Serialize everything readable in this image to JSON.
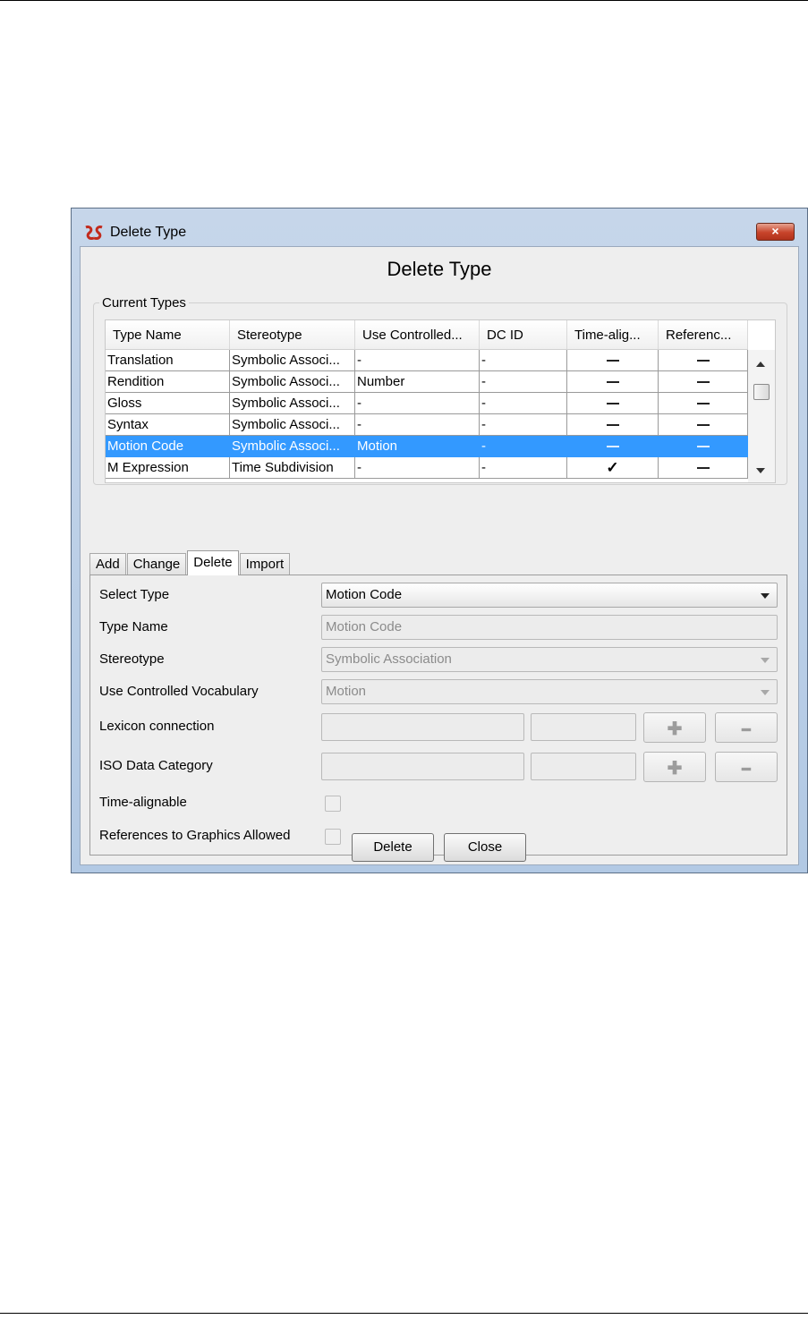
{
  "dialog": {
    "window_title": "Delete Type",
    "heading": "Delete Type",
    "close_glyph": "×"
  },
  "current_types": {
    "label": "Current Types",
    "columns": [
      "Type Name",
      "Stereotype",
      "Use Controlled...",
      "DC ID",
      "Time-alig...",
      "Referenc..."
    ],
    "rows": [
      {
        "name": "Translation",
        "stereotype": "Symbolic Associ...",
        "vocab": "-",
        "dcid": "-",
        "time_alignable": "dash",
        "references": "dash",
        "selected": false
      },
      {
        "name": "Rendition",
        "stereotype": "Symbolic Associ...",
        "vocab": "Number",
        "dcid": "-",
        "time_alignable": "dash",
        "references": "dash",
        "selected": false
      },
      {
        "name": "Gloss",
        "stereotype": "Symbolic Associ...",
        "vocab": "-",
        "dcid": "-",
        "time_alignable": "dash",
        "references": "dash",
        "selected": false
      },
      {
        "name": "Syntax",
        "stereotype": "Symbolic Associ...",
        "vocab": "-",
        "dcid": "-",
        "time_alignable": "dash",
        "references": "dash",
        "selected": false
      },
      {
        "name": "Motion Code",
        "stereotype": "Symbolic Associ...",
        "vocab": "Motion",
        "dcid": "-",
        "time_alignable": "dash",
        "references": "dash",
        "selected": true
      },
      {
        "name": "M Expression",
        "stereotype": "Time Subdivision",
        "vocab": "-",
        "dcid": "-",
        "time_alignable": "check",
        "references": "dash",
        "selected": false
      }
    ]
  },
  "tabs": [
    {
      "label": "Add",
      "active": false
    },
    {
      "label": "Change",
      "active": false
    },
    {
      "label": "Delete",
      "active": true
    },
    {
      "label": "Import",
      "active": false
    }
  ],
  "form": {
    "select_type_label": "Select Type",
    "select_type_value": "Motion Code",
    "type_name_label": "Type Name",
    "type_name_value": "Motion Code",
    "stereotype_label": "Stereotype",
    "stereotype_value": "Symbolic Association",
    "vocab_label": "Use Controlled Vocabulary",
    "vocab_value": "Motion",
    "lexicon_label": "Lexicon connection",
    "iso_label": "ISO Data Category",
    "time_alignable_label": "Time-alignable",
    "graphics_label": "References to Graphics Allowed",
    "plus_glyph": "✚",
    "minus_glyph": "━"
  },
  "buttons": {
    "delete": "Delete",
    "close": "Close"
  },
  "glyphs": {
    "check": "✓"
  }
}
